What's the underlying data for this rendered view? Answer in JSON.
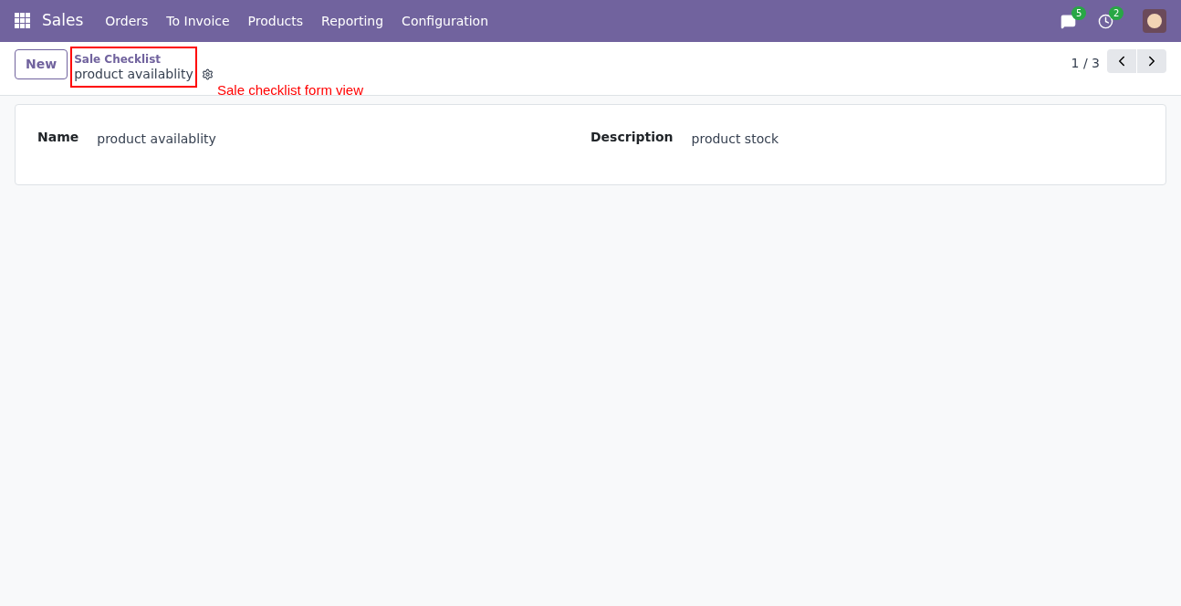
{
  "navbar": {
    "app": "Sales",
    "menu": [
      "Orders",
      "To Invoice",
      "Products",
      "Reporting",
      "Configuration"
    ],
    "messages_badge": "5",
    "activities_badge": "2"
  },
  "control_panel": {
    "new_button": "New",
    "breadcrumb": "Sale Checklist",
    "record_title": "product availablity",
    "pager": "1 / 3"
  },
  "annotation": "Sale checklist form view",
  "form": {
    "fields": [
      {
        "label": "Name",
        "value": "product availablity"
      },
      {
        "label": "Description",
        "value": "product stock"
      }
    ]
  }
}
